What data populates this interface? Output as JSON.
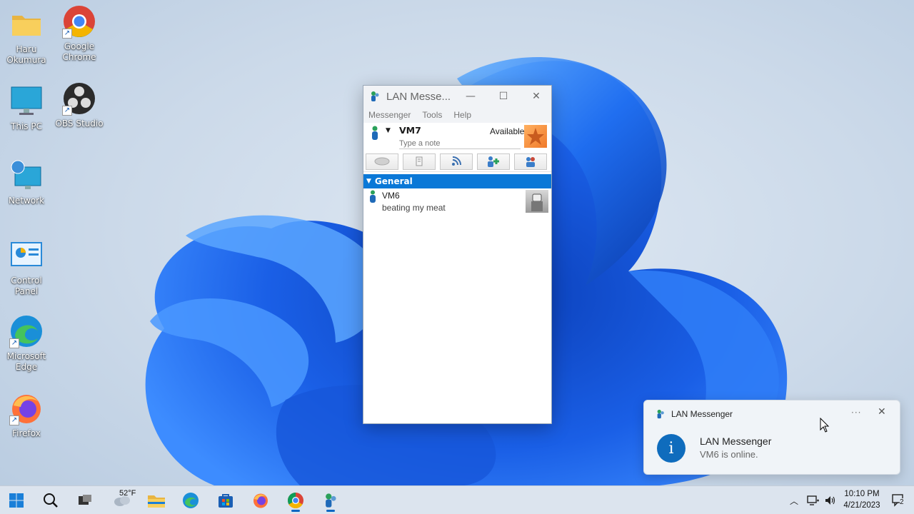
{
  "desktop": {
    "icons": [
      {
        "label": "Haru Okumura",
        "icon": "folder-icon"
      },
      {
        "label": "Google Chrome",
        "icon": "chrome-icon"
      },
      {
        "label": "This PC",
        "icon": "monitor-icon"
      },
      {
        "label": "OBS Studio",
        "icon": "obs-icon"
      },
      {
        "label": "Network",
        "icon": "network-icon"
      },
      {
        "label": "Control Panel",
        "icon": "control-panel-icon"
      },
      {
        "label": "Microsoft Edge",
        "icon": "edge-icon"
      },
      {
        "label": "Firefox",
        "icon": "firefox-icon"
      }
    ]
  },
  "messenger": {
    "title": "LAN Messe...",
    "menu": [
      "Messenger",
      "Tools",
      "Help"
    ],
    "user": {
      "name": "VM7",
      "status": "Available",
      "note_placeholder": "Type a note"
    },
    "toolbar": [
      "chat-icon",
      "file-transfer-icon",
      "broadcast-icon",
      "add-contact-icon",
      "group-icon"
    ],
    "group": {
      "name": "General",
      "contacts": [
        {
          "name": "VM6",
          "note": "beating my meat"
        }
      ]
    }
  },
  "notification": {
    "app": "LAN Messenger",
    "title": "LAN Messenger",
    "message": "VM6 is online.",
    "more": "···",
    "close": "✕"
  },
  "taskbar": {
    "weather_temp": "52°F",
    "time": "10:10 PM",
    "date": "4/21/2023",
    "notification_count": "2"
  },
  "colors": {
    "accent": "#0a78d7",
    "wallpaper": "#1e63e8"
  }
}
